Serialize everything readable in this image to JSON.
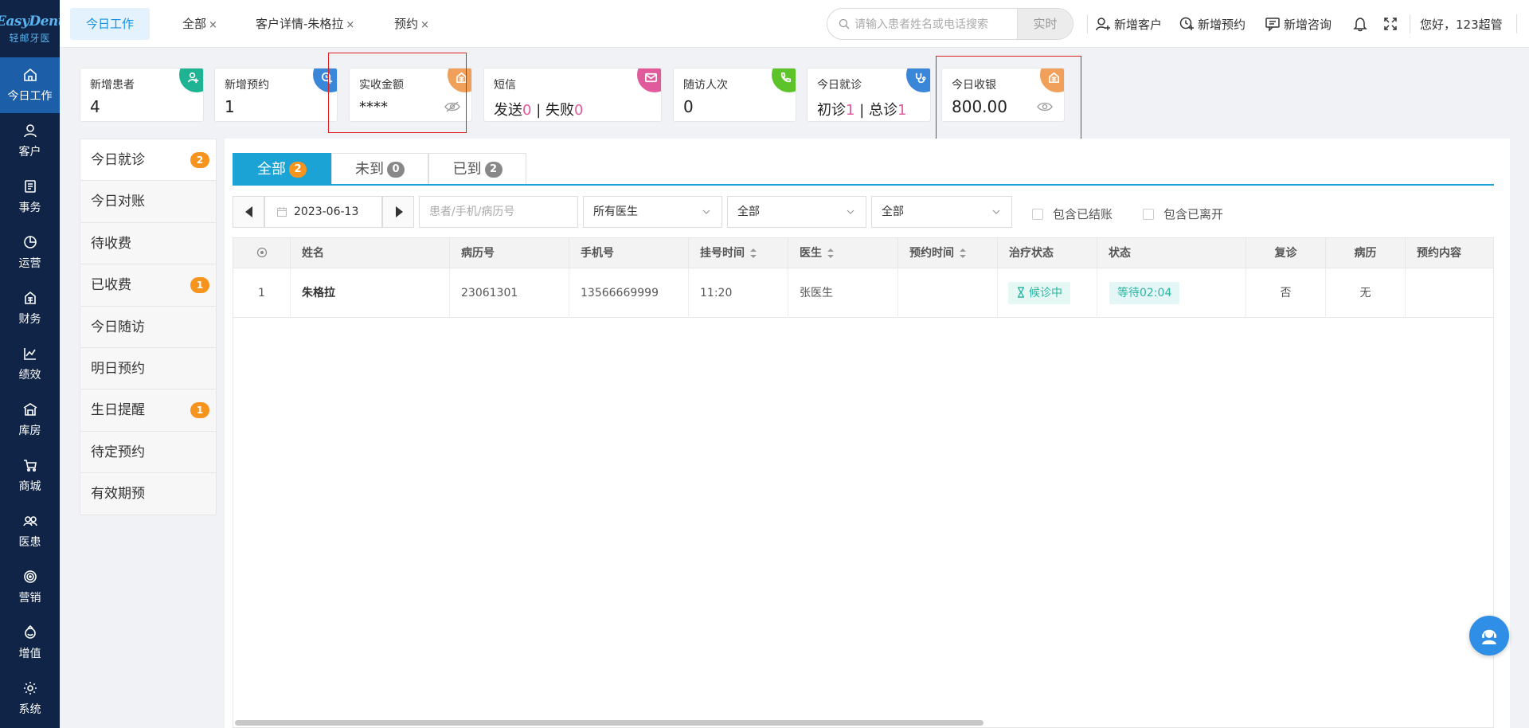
{
  "brand": {
    "name_en": "EasyDent",
    "name_cn": "轻邮牙医",
    "accent": "#1c5fa8"
  },
  "sidebar": {
    "items": [
      {
        "label": "今日工作",
        "icon": "home-icon"
      },
      {
        "label": "客户",
        "icon": "user-icon"
      },
      {
        "label": "事务",
        "icon": "task-icon"
      },
      {
        "label": "运营",
        "icon": "pie-chart-icon"
      },
      {
        "label": "财务",
        "icon": "finance-icon"
      },
      {
        "label": "绩效",
        "icon": "line-chart-icon"
      },
      {
        "label": "库房",
        "icon": "warehouse-icon"
      },
      {
        "label": "商城",
        "icon": "cart-icon"
      },
      {
        "label": "医患",
        "icon": "doctor-patient-icon"
      },
      {
        "label": "营销",
        "icon": "target-icon"
      },
      {
        "label": "增值",
        "icon": "value-added-icon"
      },
      {
        "label": "系统",
        "icon": "gear-icon"
      }
    ]
  },
  "topbar": {
    "tabs": [
      {
        "label": "今日工作",
        "closable": false
      },
      {
        "label": "全部",
        "closable": true
      },
      {
        "label": "客户详情-朱格拉",
        "closable": true
      },
      {
        "label": "预约",
        "closable": true
      }
    ],
    "close_glyph": "×",
    "search_placeholder": "请输入患者姓名或电话搜索",
    "search_button": "实时",
    "actions": {
      "add_customer": "新增客户",
      "add_appointment": "新增预约",
      "add_consult": "新增咨询"
    },
    "greeting": "您好，123超管"
  },
  "stats": {
    "new_patients": {
      "title": "新增患者",
      "value": "4",
      "color": "#1db393"
    },
    "new_appointments": {
      "title": "新增预约",
      "value": "1",
      "color": "#3a86d8"
    },
    "received_amount": {
      "title": "实收金额",
      "value": "****",
      "color": "#f0a05a"
    },
    "sms": {
      "title": "短信",
      "sent_label": "发送",
      "sent": "0",
      "sep": "|",
      "failed_label": "失败",
      "failed": "0",
      "color": "#e05a9c"
    },
    "followups": {
      "title": "随访人次",
      "value": "0",
      "color": "#5cc42a"
    },
    "visits": {
      "title": "今日就诊",
      "first_label": "初诊",
      "first": "1",
      "sep": "|",
      "total_label": "总诊",
      "total": "1",
      "color": "#3a86d8"
    },
    "cashier": {
      "title": "今日收银",
      "value": "800.00",
      "color": "#f0a05a"
    }
  },
  "leftlist": {
    "items": [
      {
        "label": "今日就诊",
        "badge": "2"
      },
      {
        "label": "今日对账",
        "badge": ""
      },
      {
        "label": "待收费",
        "badge": ""
      },
      {
        "label": "已收费",
        "badge": "1"
      },
      {
        "label": "今日随访",
        "badge": ""
      },
      {
        "label": "明日预约",
        "badge": ""
      },
      {
        "label": "生日提醒",
        "badge": "1"
      },
      {
        "label": "待定预约",
        "badge": ""
      },
      {
        "label": "有效期预",
        "badge": ""
      }
    ]
  },
  "subtabs": [
    {
      "label": "全部",
      "count": "2"
    },
    {
      "label": "未到",
      "count": "0"
    },
    {
      "label": "已到",
      "count": "2"
    }
  ],
  "filters": {
    "date": "2023-06-13",
    "search_placeholder": "患者/手机/病历号",
    "doctor": "所有医生",
    "select2": "全部",
    "select3": "全部",
    "include_settled": "包含已结账",
    "include_left": "包含已离开"
  },
  "table": {
    "headers": [
      "",
      "姓名",
      "病历号",
      "手机号",
      "挂号时间",
      "医生",
      "预约时间",
      "治疗状态",
      "状态",
      "复诊",
      "病历",
      "预约内容"
    ],
    "rows": [
      {
        "index": "1",
        "name": "朱格拉",
        "record_no": "23061301",
        "phone": "13566669999",
        "reg_time": "11:20",
        "doctor": "张医生",
        "appt_time": "",
        "treat_status": "候诊中",
        "status": "等待02:04",
        "revisit": "否",
        "record": "无",
        "appt_content": ""
      }
    ]
  }
}
